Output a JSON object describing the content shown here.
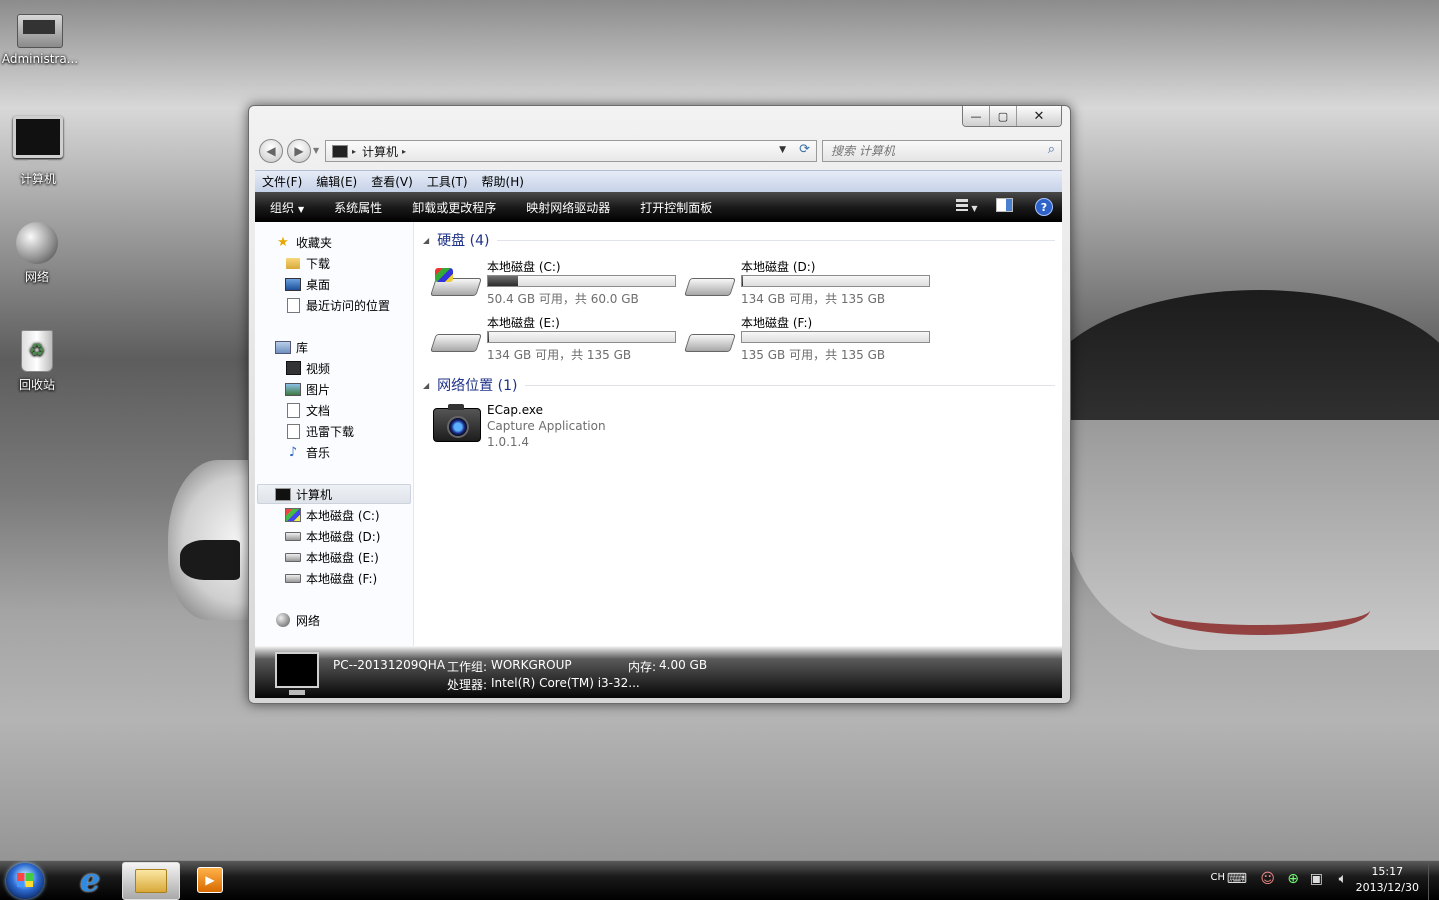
{
  "desktop": {
    "icons": [
      {
        "label": "Administra...",
        "icon": "user-folder-icon"
      },
      {
        "label": "计算机",
        "icon": "computer-icon"
      },
      {
        "label": "网络",
        "icon": "network-icon"
      },
      {
        "label": "回收站",
        "icon": "recycle-bin-icon"
      }
    ]
  },
  "window": {
    "caption": {
      "minimize": "—",
      "maximize": "▢",
      "close": "✕"
    },
    "address": {
      "location": "计算机",
      "separator": "▸"
    },
    "search": {
      "placeholder": "搜索 计算机"
    },
    "menu": [
      "文件(F)",
      "编辑(E)",
      "查看(V)",
      "工具(T)",
      "帮助(H)"
    ],
    "toolbar": {
      "organize": "组织",
      "items": [
        "系统属性",
        "卸载或更改程序",
        "映射网络驱动器",
        "打开控制面板"
      ],
      "help": "?"
    },
    "nav": {
      "favorites": {
        "label": "收藏夹",
        "items": [
          "下载",
          "桌面",
          "最近访问的位置"
        ]
      },
      "libraries": {
        "label": "库",
        "items": [
          "视频",
          "图片",
          "文档",
          "迅雷下载",
          "音乐"
        ]
      },
      "computer": {
        "label": "计算机",
        "items": [
          "本地磁盘 (C:)",
          "本地磁盘 (D:)",
          "本地磁盘 (E:)",
          "本地磁盘 (F:)"
        ]
      },
      "network": {
        "label": "网络"
      }
    },
    "sections": {
      "hard_disks": "硬盘 (4)",
      "network_locations": "网络位置 (1)"
    },
    "drives": [
      {
        "name": "本地磁盘 (C:)",
        "free": "50.4 GB 可用，共 60.0 GB",
        "used_fraction": 0.16,
        "system": true
      },
      {
        "name": "本地磁盘 (D:)",
        "free": "134 GB 可用，共 135 GB",
        "used_fraction": 0.007,
        "system": false
      },
      {
        "name": "本地磁盘 (E:)",
        "free": "134 GB 可用，共 135 GB",
        "used_fraction": 0.007,
        "system": false
      },
      {
        "name": "本地磁盘 (F:)",
        "free": "135 GB 可用，共 135 GB",
        "used_fraction": 0.0,
        "system": false
      }
    ],
    "network_item": {
      "name": "ECap.exe",
      "description": "Capture Application",
      "version": "1.0.1.4"
    },
    "details": {
      "pc_name": "PC--20131209QHA",
      "workgroup_label": "工作组:",
      "workgroup": "WORKGROUP",
      "memory_label": "内存:",
      "memory": "4.00 GB",
      "processor_label": "处理器:",
      "processor": "Intel(R) Core(TM) i3-32..."
    }
  },
  "taskbar": {
    "language": "CH",
    "time": "15:17",
    "date": "2013/12/30"
  }
}
